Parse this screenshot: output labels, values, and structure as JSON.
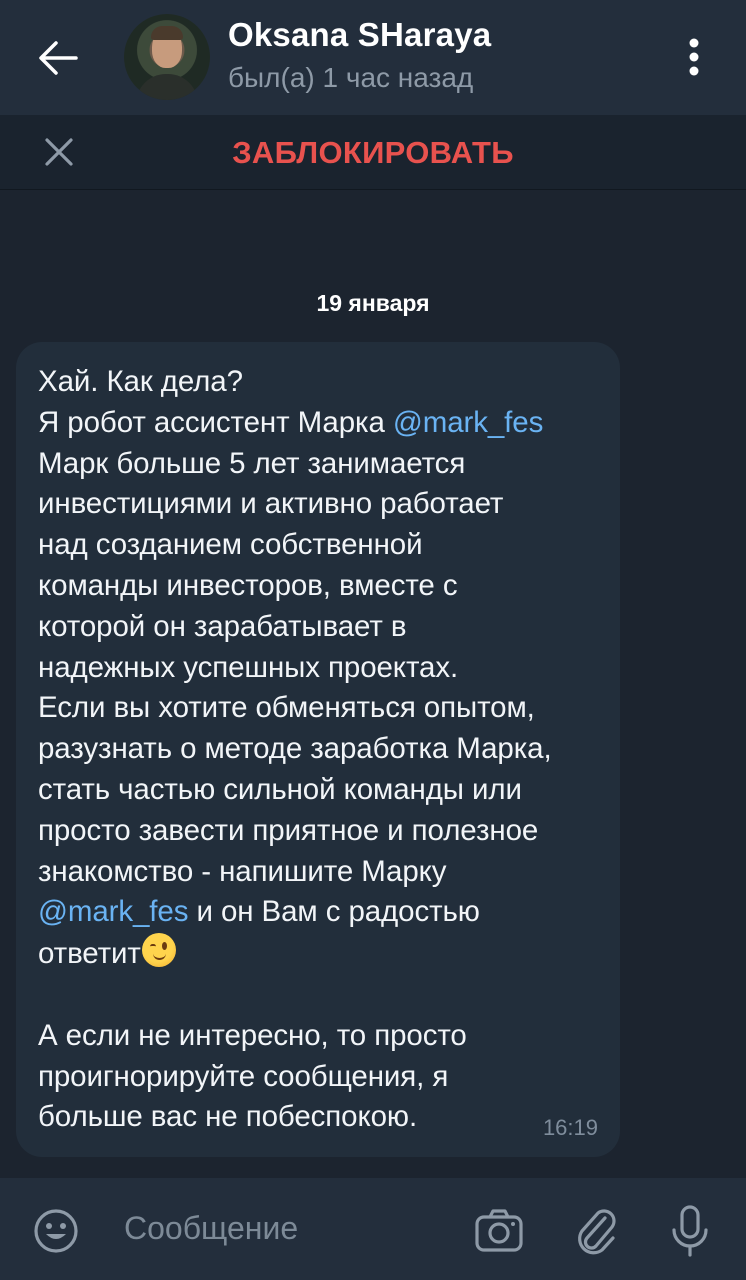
{
  "header": {
    "name": "Oksana SHaraya",
    "status": "был(а) 1 час назад"
  },
  "banner": {
    "block_label": "ЗАБЛОКИРОВАТЬ"
  },
  "chat": {
    "date": "19 января",
    "message": {
      "line1": "Хай. Как дела?",
      "line2_prefix": "Я робот ассистент Марка ",
      "mention": "@mark_fes",
      "body": "Марк больше 5 лет занимается\nинвестициями и активно работает\nнад созданием собственной\nкоманды инвесторов, вместе с\nкоторой он зарабатывает в\nнадежных успешных проектах.\nЕсли вы хотите обменяться опытом,\nразузнать о методе заработка Марка,\nстать частью сильной команды или\nпросто завести приятное и полезное\nзнакомство - напишите Марку",
      "mention2": "@mark_fes",
      "after_mention": " и он Вам с радостью",
      "reply_word": "ответит",
      "emoji": "winking-face",
      "closing": "А если не интересно, то просто\nпроигнорируйте сообщения, я\nбольше вас не побеспокою.",
      "time": "16:19"
    }
  },
  "composer": {
    "placeholder": "Сообщение"
  },
  "colors": {
    "accent_link": "#6ab3f3",
    "block_red": "#e8524e",
    "background": "#1c242f",
    "bar": "#232e3c"
  }
}
